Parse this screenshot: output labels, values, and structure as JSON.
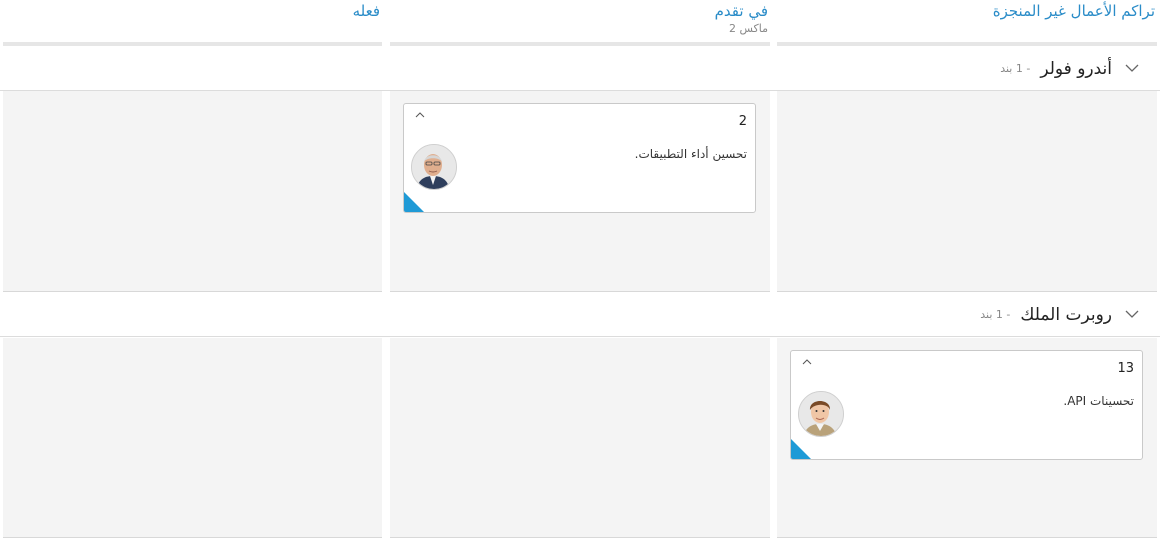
{
  "columns": [
    {
      "title": "تراكم الأعمال غير المنجزة",
      "subtitle": ""
    },
    {
      "title": "في تقدم",
      "subtitle": "ماكس 2"
    },
    {
      "title": "فعله",
      "subtitle": ""
    }
  ],
  "lanes": [
    {
      "name": "أندرو فولر",
      "count": "- 1 بند",
      "card": {
        "id": "2",
        "text": "تحسين أداء التطبيقات.",
        "column": 1,
        "avatar": "avatar-older-man"
      }
    },
    {
      "name": "روبرت الملك",
      "count": "- 1 بند",
      "card": {
        "id": "13",
        "text": "تحسينات API.",
        "column": 0,
        "avatar": "avatar-young-man"
      }
    }
  ],
  "colors": {
    "header_text": "#2a8cc8",
    "cell_bg": "#f4f4f4",
    "card_corner": "#1f9ad6"
  }
}
